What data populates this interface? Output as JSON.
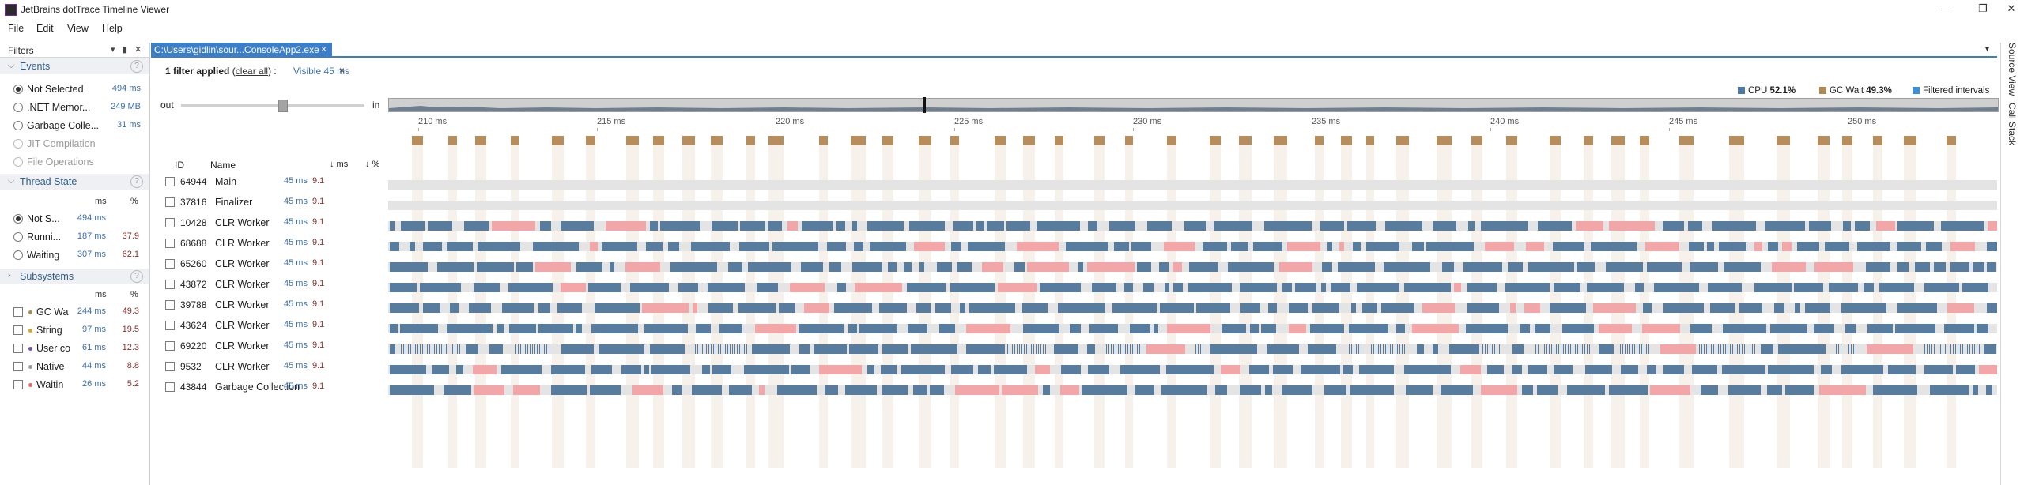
{
  "window": {
    "title": "JetBrains dotTrace Timeline Viewer",
    "minimize": "—",
    "maximize": "❐",
    "close": "✕"
  },
  "menu": [
    "File",
    "Edit",
    "View",
    "Help"
  ],
  "filters_panel": {
    "title": "Filters",
    "events": {
      "title": "Events",
      "items": [
        {
          "label": "Not Selected",
          "value": "494 ms",
          "selected": true
        },
        {
          "label": ".NET Memor...",
          "value": "249 MB",
          "selected": false
        },
        {
          "label": "Garbage Colle...",
          "value": "31 ms",
          "selected": false
        },
        {
          "label": "JIT Compilation",
          "value": "",
          "disabled": true
        },
        {
          "label": "File Operations",
          "value": "",
          "disabled": true
        }
      ]
    },
    "thread_state": {
      "title": "Thread State",
      "col_ms": "ms",
      "col_pct": "%",
      "items": [
        {
          "label": "Not S...",
          "ms": "494 ms",
          "pct": "",
          "selected": true
        },
        {
          "label": "Runni...",
          "ms": "187 ms",
          "pct": "37.9",
          "selected": false
        },
        {
          "label": "Waiting",
          "ms": "307 ms",
          "pct": "62.1",
          "selected": false
        }
      ]
    },
    "subsystems": {
      "title": "Subsystems",
      "col_ms": "ms",
      "col_pct": "%",
      "items": [
        {
          "label": "GC Wa",
          "ms": "244 ms",
          "pct": "49.3",
          "color": "#b08a55"
        },
        {
          "label": "String",
          "ms": "97 ms",
          "pct": "19.5",
          "color": "#e0a020"
        },
        {
          "label": "User co",
          "ms": "61 ms",
          "pct": "12.3",
          "color": "#7a4fb0"
        },
        {
          "label": "Native",
          "ms": "44 ms",
          "pct": "8.8",
          "color": "#9a9a9a"
        },
        {
          "label": "Waitin",
          "ms": "26 ms",
          "pct": "5.2",
          "color": "#e06a6a"
        }
      ]
    }
  },
  "document_tab": {
    "label": "C:\\Users\\gidlin\\sour...ConsoleApp2.exe",
    "close": "×"
  },
  "filter_bar": {
    "count_text": "1 filter applied",
    "clear_text": "clear all",
    "visible_text": "Visible 45 ms",
    "close": "×"
  },
  "zoom": {
    "out_label": "out",
    "in_label": "in"
  },
  "legend": [
    {
      "label": "CPU",
      "value": "52.1%",
      "color": "#4f79a0"
    },
    {
      "label": "GC Wait",
      "value": "49.3%",
      "color": "#b08a55"
    },
    {
      "label": "Filtered intervals",
      "value": "",
      "color": "#3d8fd6"
    }
  ],
  "timeline": {
    "ticks": [
      "210 ms",
      "215 ms",
      "220 ms",
      "225 ms",
      "230 ms",
      "235 ms",
      "240 ms",
      "245 ms",
      "250 ms"
    ]
  },
  "threads_header": {
    "id": "ID",
    "name": "Name",
    "ms": "↓ ms",
    "pct": "↓ %"
  },
  "threads": [
    {
      "id": "64944",
      "name": "Main",
      "ms": "45 ms",
      "pct": "9.1"
    },
    {
      "id": "37816",
      "name": "Finalizer",
      "ms": "45 ms",
      "pct": "9.1"
    },
    {
      "id": "10428",
      "name": "CLR Worker",
      "ms": "45 ms",
      "pct": "9.1"
    },
    {
      "id": "68688",
      "name": "CLR Worker",
      "ms": "45 ms",
      "pct": "9.1"
    },
    {
      "id": "65260",
      "name": "CLR Worker",
      "ms": "45 ms",
      "pct": "9.1"
    },
    {
      "id": "43872",
      "name": "CLR Worker",
      "ms": "45 ms",
      "pct": "9.1"
    },
    {
      "id": "39788",
      "name": "CLR Worker",
      "ms": "45 ms",
      "pct": "9.1"
    },
    {
      "id": "43624",
      "name": "CLR Worker",
      "ms": "45 ms",
      "pct": "9.1"
    },
    {
      "id": "69220",
      "name": "CLR Worker",
      "ms": "45 ms",
      "pct": "9.1"
    },
    {
      "id": "9532",
      "name": "CLR Worker",
      "ms": "45 ms",
      "pct": "9.1"
    },
    {
      "id": "43844",
      "name": "Garbage Collection",
      "ms": "45 ms",
      "pct": "9.1"
    }
  ],
  "side_tabs": [
    "Source View",
    "Call Stack"
  ]
}
